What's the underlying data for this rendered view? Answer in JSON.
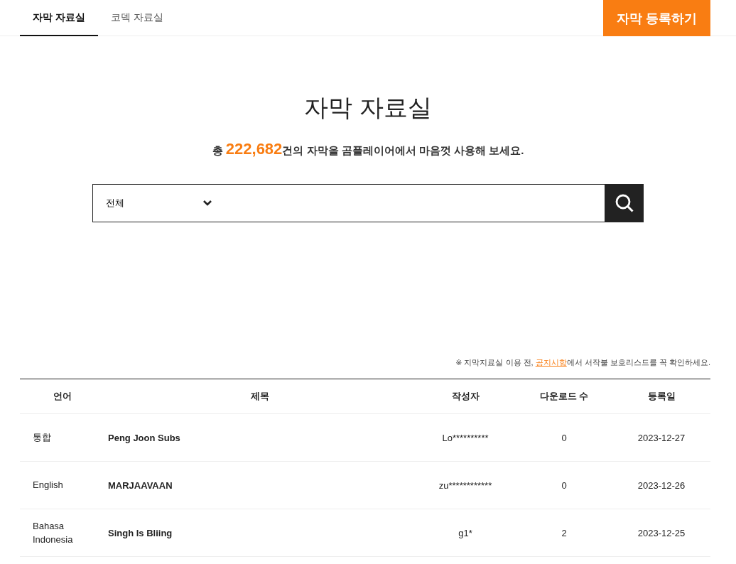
{
  "tabs": [
    {
      "label": "자막 자료실",
      "selected": true
    },
    {
      "label": "코덱 자료실",
      "selected": false
    }
  ],
  "register_button": "자막 등록하기",
  "heading": "자막 자료실",
  "summary": {
    "before": "총",
    "count": "222,682",
    "after": "건의 자막을 곰플레이어에서 마음껏 사용해 보세요."
  },
  "search": {
    "category": "전체"
  },
  "notice": {
    "before": "※ 지막지료실 이용 전, ",
    "link": "공지시항",
    "after": "에서 서작불 보호리스드를 꼭 확인하세요."
  },
  "table": {
    "columns": [
      "언어",
      "제목",
      "작성자",
      "다운로드 수",
      "등록일"
    ],
    "rows": [
      {
        "language": "통합",
        "title": "Peng Joon Subs",
        "author": "Lo**********",
        "downloads": "0",
        "date": "2023-12-27"
      },
      {
        "language": "English",
        "title": "MARJAAVAAN",
        "author": "zu************",
        "downloads": "0",
        "date": "2023-12-26"
      },
      {
        "language": "Bahasa Indonesia",
        "title": "Singh Is Bliing",
        "author": "g1*",
        "downloads": "2",
        "date": "2023-12-25"
      }
    ]
  }
}
